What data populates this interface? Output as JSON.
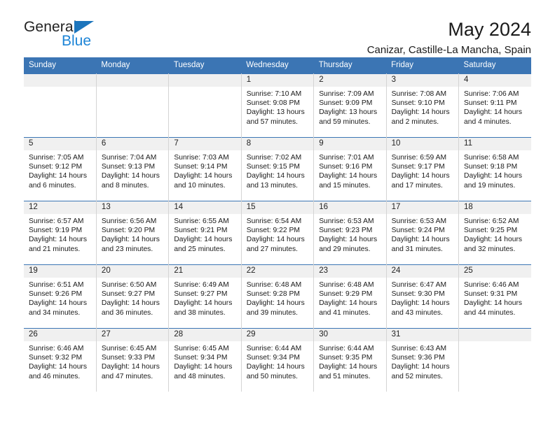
{
  "brand": {
    "name_top": "General",
    "name_bottom": "Blue",
    "accent_color": "#1c84d6",
    "triangle_color": "#1c75bc"
  },
  "header": {
    "title": "May 2024",
    "subtitle": "Canizar, Castille-La Mancha, Spain"
  },
  "theme": {
    "header_bg": "#3b75b4",
    "daynum_bg": "#f0f0f0",
    "cell_border": "#d4d4d4",
    "text_color": "#1a1a1a"
  },
  "weekday_headers": [
    "Sunday",
    "Monday",
    "Tuesday",
    "Wednesday",
    "Thursday",
    "Friday",
    "Saturday"
  ],
  "labels": {
    "sunrise_prefix": "Sunrise:",
    "sunset_prefix": "Sunset:",
    "daylight_prefix": "Daylight:"
  },
  "weeks": [
    [
      {
        "day": "",
        "sunrise": "",
        "sunset": "",
        "daylight_line1": "",
        "daylight_line2": "",
        "empty": true
      },
      {
        "day": "",
        "sunrise": "",
        "sunset": "",
        "daylight_line1": "",
        "daylight_line2": "",
        "empty": true
      },
      {
        "day": "",
        "sunrise": "",
        "sunset": "",
        "daylight_line1": "",
        "daylight_line2": "",
        "empty": true
      },
      {
        "day": "1",
        "sunrise": "Sunrise: 7:10 AM",
        "sunset": "Sunset: 9:08 PM",
        "daylight_line1": "Daylight: 13 hours",
        "daylight_line2": "and 57 minutes.",
        "empty": false
      },
      {
        "day": "2",
        "sunrise": "Sunrise: 7:09 AM",
        "sunset": "Sunset: 9:09 PM",
        "daylight_line1": "Daylight: 13 hours",
        "daylight_line2": "and 59 minutes.",
        "empty": false
      },
      {
        "day": "3",
        "sunrise": "Sunrise: 7:08 AM",
        "sunset": "Sunset: 9:10 PM",
        "daylight_line1": "Daylight: 14 hours",
        "daylight_line2": "and 2 minutes.",
        "empty": false
      },
      {
        "day": "4",
        "sunrise": "Sunrise: 7:06 AM",
        "sunset": "Sunset: 9:11 PM",
        "daylight_line1": "Daylight: 14 hours",
        "daylight_line2": "and 4 minutes.",
        "empty": false
      }
    ],
    [
      {
        "day": "5",
        "sunrise": "Sunrise: 7:05 AM",
        "sunset": "Sunset: 9:12 PM",
        "daylight_line1": "Daylight: 14 hours",
        "daylight_line2": "and 6 minutes.",
        "empty": false
      },
      {
        "day": "6",
        "sunrise": "Sunrise: 7:04 AM",
        "sunset": "Sunset: 9:13 PM",
        "daylight_line1": "Daylight: 14 hours",
        "daylight_line2": "and 8 minutes.",
        "empty": false
      },
      {
        "day": "7",
        "sunrise": "Sunrise: 7:03 AM",
        "sunset": "Sunset: 9:14 PM",
        "daylight_line1": "Daylight: 14 hours",
        "daylight_line2": "and 10 minutes.",
        "empty": false
      },
      {
        "day": "8",
        "sunrise": "Sunrise: 7:02 AM",
        "sunset": "Sunset: 9:15 PM",
        "daylight_line1": "Daylight: 14 hours",
        "daylight_line2": "and 13 minutes.",
        "empty": false
      },
      {
        "day": "9",
        "sunrise": "Sunrise: 7:01 AM",
        "sunset": "Sunset: 9:16 PM",
        "daylight_line1": "Daylight: 14 hours",
        "daylight_line2": "and 15 minutes.",
        "empty": false
      },
      {
        "day": "10",
        "sunrise": "Sunrise: 6:59 AM",
        "sunset": "Sunset: 9:17 PM",
        "daylight_line1": "Daylight: 14 hours",
        "daylight_line2": "and 17 minutes.",
        "empty": false
      },
      {
        "day": "11",
        "sunrise": "Sunrise: 6:58 AM",
        "sunset": "Sunset: 9:18 PM",
        "daylight_line1": "Daylight: 14 hours",
        "daylight_line2": "and 19 minutes.",
        "empty": false
      }
    ],
    [
      {
        "day": "12",
        "sunrise": "Sunrise: 6:57 AM",
        "sunset": "Sunset: 9:19 PM",
        "daylight_line1": "Daylight: 14 hours",
        "daylight_line2": "and 21 minutes.",
        "empty": false
      },
      {
        "day": "13",
        "sunrise": "Sunrise: 6:56 AM",
        "sunset": "Sunset: 9:20 PM",
        "daylight_line1": "Daylight: 14 hours",
        "daylight_line2": "and 23 minutes.",
        "empty": false
      },
      {
        "day": "14",
        "sunrise": "Sunrise: 6:55 AM",
        "sunset": "Sunset: 9:21 PM",
        "daylight_line1": "Daylight: 14 hours",
        "daylight_line2": "and 25 minutes.",
        "empty": false
      },
      {
        "day": "15",
        "sunrise": "Sunrise: 6:54 AM",
        "sunset": "Sunset: 9:22 PM",
        "daylight_line1": "Daylight: 14 hours",
        "daylight_line2": "and 27 minutes.",
        "empty": false
      },
      {
        "day": "16",
        "sunrise": "Sunrise: 6:53 AM",
        "sunset": "Sunset: 9:23 PM",
        "daylight_line1": "Daylight: 14 hours",
        "daylight_line2": "and 29 minutes.",
        "empty": false
      },
      {
        "day": "17",
        "sunrise": "Sunrise: 6:53 AM",
        "sunset": "Sunset: 9:24 PM",
        "daylight_line1": "Daylight: 14 hours",
        "daylight_line2": "and 31 minutes.",
        "empty": false
      },
      {
        "day": "18",
        "sunrise": "Sunrise: 6:52 AM",
        "sunset": "Sunset: 9:25 PM",
        "daylight_line1": "Daylight: 14 hours",
        "daylight_line2": "and 32 minutes.",
        "empty": false
      }
    ],
    [
      {
        "day": "19",
        "sunrise": "Sunrise: 6:51 AM",
        "sunset": "Sunset: 9:26 PM",
        "daylight_line1": "Daylight: 14 hours",
        "daylight_line2": "and 34 minutes.",
        "empty": false
      },
      {
        "day": "20",
        "sunrise": "Sunrise: 6:50 AM",
        "sunset": "Sunset: 9:27 PM",
        "daylight_line1": "Daylight: 14 hours",
        "daylight_line2": "and 36 minutes.",
        "empty": false
      },
      {
        "day": "21",
        "sunrise": "Sunrise: 6:49 AM",
        "sunset": "Sunset: 9:27 PM",
        "daylight_line1": "Daylight: 14 hours",
        "daylight_line2": "and 38 minutes.",
        "empty": false
      },
      {
        "day": "22",
        "sunrise": "Sunrise: 6:48 AM",
        "sunset": "Sunset: 9:28 PM",
        "daylight_line1": "Daylight: 14 hours",
        "daylight_line2": "and 39 minutes.",
        "empty": false
      },
      {
        "day": "23",
        "sunrise": "Sunrise: 6:48 AM",
        "sunset": "Sunset: 9:29 PM",
        "daylight_line1": "Daylight: 14 hours",
        "daylight_line2": "and 41 minutes.",
        "empty": false
      },
      {
        "day": "24",
        "sunrise": "Sunrise: 6:47 AM",
        "sunset": "Sunset: 9:30 PM",
        "daylight_line1": "Daylight: 14 hours",
        "daylight_line2": "and 43 minutes.",
        "empty": false
      },
      {
        "day": "25",
        "sunrise": "Sunrise: 6:46 AM",
        "sunset": "Sunset: 9:31 PM",
        "daylight_line1": "Daylight: 14 hours",
        "daylight_line2": "and 44 minutes.",
        "empty": false
      }
    ],
    [
      {
        "day": "26",
        "sunrise": "Sunrise: 6:46 AM",
        "sunset": "Sunset: 9:32 PM",
        "daylight_line1": "Daylight: 14 hours",
        "daylight_line2": "and 46 minutes.",
        "empty": false
      },
      {
        "day": "27",
        "sunrise": "Sunrise: 6:45 AM",
        "sunset": "Sunset: 9:33 PM",
        "daylight_line1": "Daylight: 14 hours",
        "daylight_line2": "and 47 minutes.",
        "empty": false
      },
      {
        "day": "28",
        "sunrise": "Sunrise: 6:45 AM",
        "sunset": "Sunset: 9:34 PM",
        "daylight_line1": "Daylight: 14 hours",
        "daylight_line2": "and 48 minutes.",
        "empty": false
      },
      {
        "day": "29",
        "sunrise": "Sunrise: 6:44 AM",
        "sunset": "Sunset: 9:34 PM",
        "daylight_line1": "Daylight: 14 hours",
        "daylight_line2": "and 50 minutes.",
        "empty": false
      },
      {
        "day": "30",
        "sunrise": "Sunrise: 6:44 AM",
        "sunset": "Sunset: 9:35 PM",
        "daylight_line1": "Daylight: 14 hours",
        "daylight_line2": "and 51 minutes.",
        "empty": false
      },
      {
        "day": "31",
        "sunrise": "Sunrise: 6:43 AM",
        "sunset": "Sunset: 9:36 PM",
        "daylight_line1": "Daylight: 14 hours",
        "daylight_line2": "and 52 minutes.",
        "empty": false
      },
      {
        "day": "",
        "sunrise": "",
        "sunset": "",
        "daylight_line1": "",
        "daylight_line2": "",
        "empty": true
      }
    ]
  ]
}
